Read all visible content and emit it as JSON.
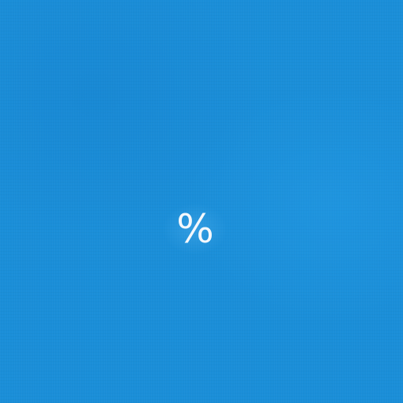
{
  "screen": {
    "background_color": "#1a8ed8",
    "center_symbol": "%",
    "center_symbol_color": "#f4f8fc"
  }
}
